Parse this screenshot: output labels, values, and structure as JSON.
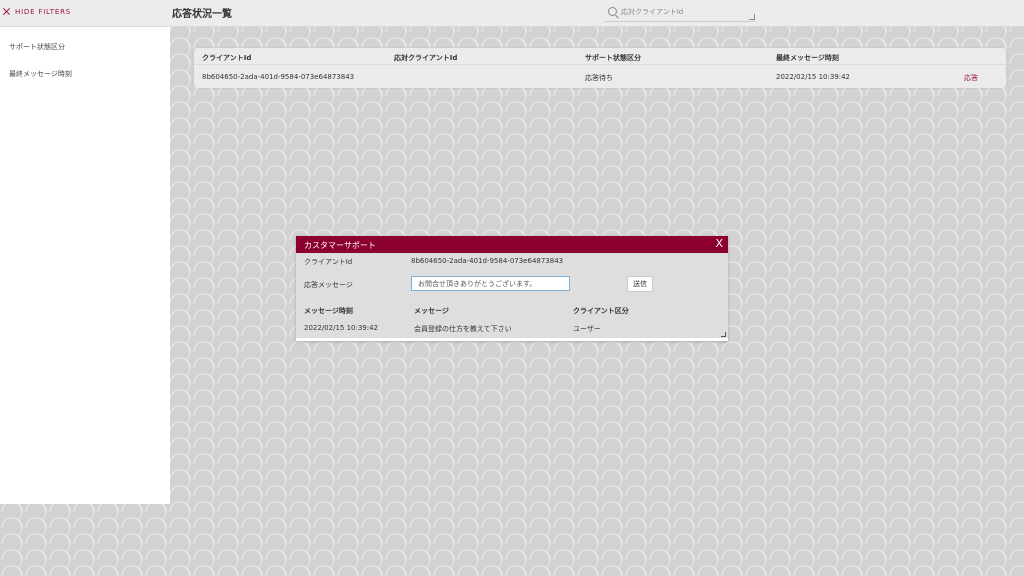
{
  "header": {
    "hide_filters_label": "HIDE FILTERS",
    "title": "応答状況一覧",
    "search_placeholder": "応対クライアントId"
  },
  "sidebar": {
    "filters": [
      {
        "label": "サポート状態区分"
      },
      {
        "label": "最終メッセージ時刻"
      }
    ]
  },
  "table": {
    "columns": [
      "クライアントId",
      "応対クライアントId",
      "サポート状態区分",
      "最終メッセージ時刻"
    ],
    "rows": [
      {
        "client_id": "8b604650-2ada-401d-9584-073e64873843",
        "responder_id": "",
        "status": "応答待ち",
        "last_message_time": "2022/02/15 10:39:42",
        "action": "応答"
      }
    ]
  },
  "dialog": {
    "title": "カスタマーサポート",
    "close": "X",
    "client_id_label": "クライアントId",
    "client_id_value": "8b604650-2ada-401d-9584-073e64873843",
    "message_label": "応答メッセージ",
    "message_value": "お問合せ頂きありがとうございます。",
    "send_label": "送信",
    "columns": [
      "メッセージ時刻",
      "メッセージ",
      "クライアント区分"
    ],
    "rows": [
      {
        "time": "2022/02/15 10:39:42",
        "message": "会員登録の仕方を教えて下さい",
        "client_type": "ユーザー"
      }
    ]
  },
  "colors": {
    "accent": "#8c0030",
    "link": "#9a1239",
    "background": "#d2d2d2"
  }
}
